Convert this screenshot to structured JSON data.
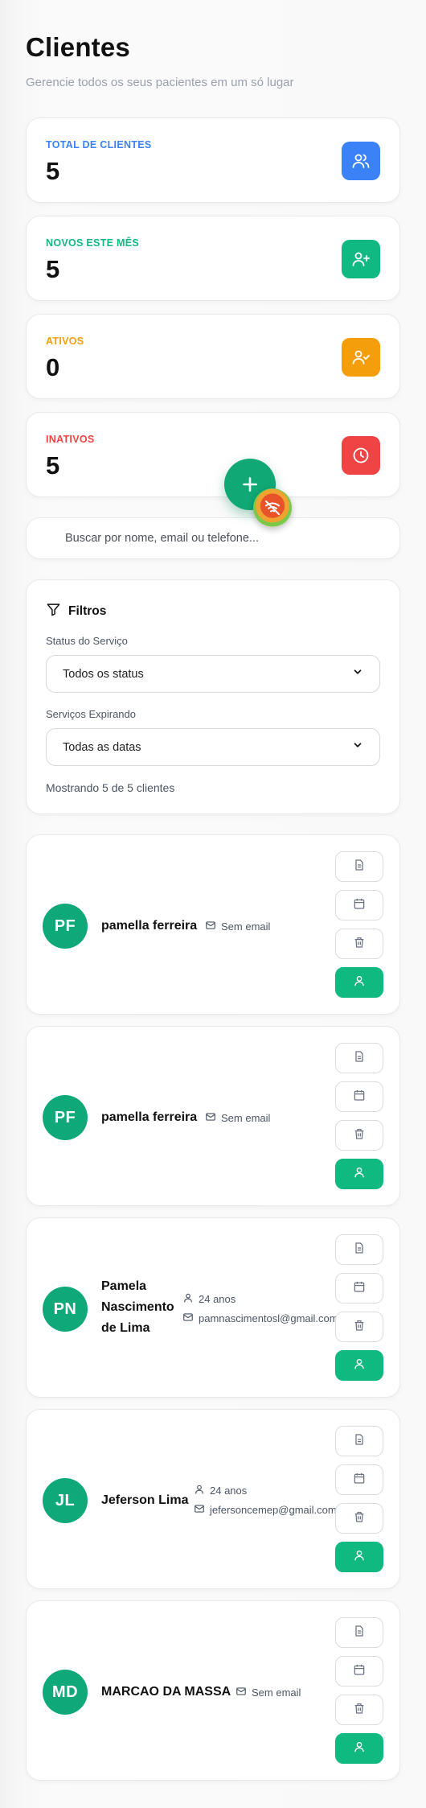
{
  "header": {
    "title": "Clientes",
    "subtitle": "Gerencie todos os seus pacientes em um só lugar"
  },
  "stats": [
    {
      "label": "TOTAL DE CLIENTES",
      "value": "5",
      "color": "#3b82f6",
      "icon": "users-icon"
    },
    {
      "label": "NOVOS ESTE MÊS",
      "value": "5",
      "color": "#10b981",
      "icon": "user-plus-icon"
    },
    {
      "label": "ATIVOS",
      "value": "0",
      "color": "#f59e0b",
      "icon": "user-check-icon"
    },
    {
      "label": "INATIVOS",
      "value": "5",
      "color": "#ef4444",
      "icon": "clock-icon"
    }
  ],
  "search": {
    "placeholder": "Buscar por nome, email ou telefone..."
  },
  "filters": {
    "title": "Filtros",
    "status_label": "Status do Serviço",
    "status_value": "Todos os status",
    "expiring_label": "Serviços Expirando",
    "expiring_value": "Todas as datas",
    "showing": "Mostrando 5 de 5 clientes"
  },
  "clients": [
    {
      "initials": "PF",
      "name": "pamella ferreira",
      "age": "",
      "email": "Sem email"
    },
    {
      "initials": "PF",
      "name": "pamella ferreira",
      "age": "",
      "email": "Sem email"
    },
    {
      "initials": "PN",
      "name_lines": [
        "Pamela",
        "Nascimento",
        "de Lima"
      ],
      "age": "24 anos",
      "email": "pamnascimentosl@gmail.com"
    },
    {
      "initials": "JL",
      "name": "Jeferson Lima",
      "age": "24 anos",
      "email": "jefersoncemep@gmail.com"
    },
    {
      "initials": "MD",
      "name": "MARCAO DA MASSA",
      "age": "",
      "email": "Sem email"
    }
  ],
  "colors": {
    "accent": "#10b981",
    "fab": "#10a874",
    "avatar": "#0fa878"
  }
}
